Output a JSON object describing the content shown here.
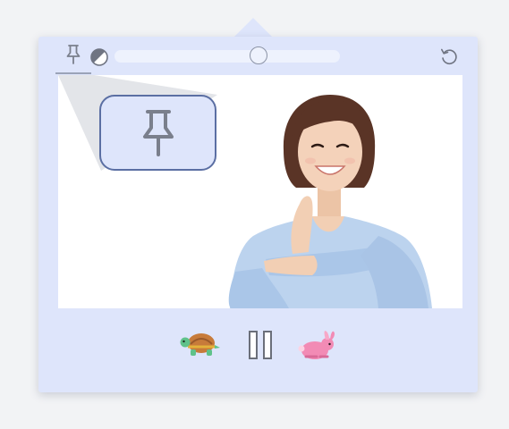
{
  "toolbar": {
    "pin_icon": "pin-icon",
    "contrast_icon": "contrast-icon",
    "reset_icon": "reset-icon",
    "slider_value": 0.65
  },
  "video": {
    "callout_icon": "pin-icon",
    "subject": "person-signing"
  },
  "controls": {
    "slow_icon": "turtle-icon",
    "pause_icon": "pause-icon",
    "fast_icon": "rabbit-icon"
  },
  "colors": {
    "panel": "#dee5fb",
    "callout_border": "#5b6fa3",
    "icon": "#7a7f8c"
  }
}
